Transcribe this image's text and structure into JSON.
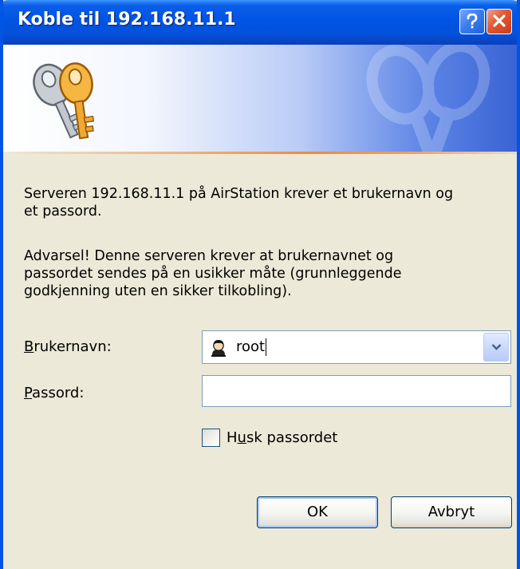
{
  "window": {
    "title": "Koble til 192.168.11.1",
    "icons": {
      "help": "help-icon",
      "close": "close-icon",
      "banner": "keys-icon",
      "user": "user-icon",
      "dropdown": "chevron-down-icon"
    },
    "colors": {
      "titlebar": "#0054e3",
      "dialog_background": "#ece9d8",
      "close_button": "#e2582e"
    }
  },
  "message": {
    "line1": "Serveren 192.168.11.1 på AirStation krever et brukernavn og\net passord.",
    "line2": "Advarsel!  Denne serveren krever at brukernavnet og\npassordet sendes på en usikker måte (grunnleggende\ngodkjenning uten en sikker tilkobling)."
  },
  "form": {
    "username_label_key": "B",
    "username_label_rest": "rukernavn:",
    "username_value": "root",
    "password_label_key": "P",
    "password_label_rest": "assord:",
    "password_value": "",
    "remember_label_pre": "H",
    "remember_label_key": "u",
    "remember_label_post": "sk passordet",
    "remember_checked": false
  },
  "buttons": {
    "ok": "OK",
    "cancel": "Avbryt"
  }
}
